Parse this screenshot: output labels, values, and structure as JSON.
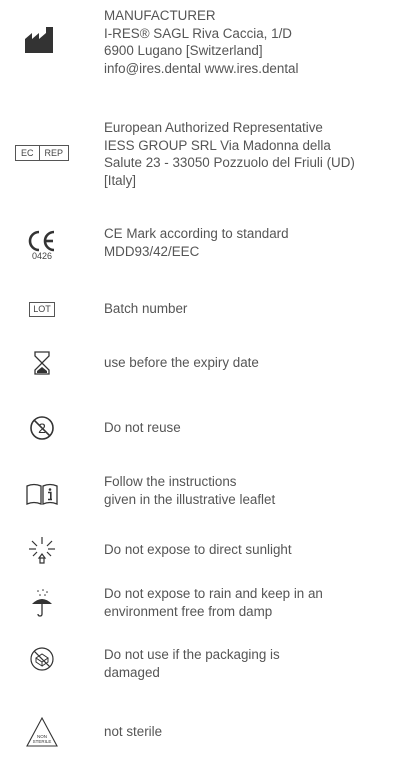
{
  "entries": [
    {
      "symbol": "manufacturer-icon",
      "lines": "MANUFACTURER\nI-RES® SAGL Riva Caccia, 1/D\n6900 Lugano [Switzerland]\ninfo@ires.dental www.ires.dental"
    },
    {
      "symbol": "ec-rep-label",
      "ec": "EC",
      "rep": "REP",
      "lines": "European Authorized Representative\nIESS GROUP SRL Via Madonna della\nSalute 23 - 33050 Pozzuolo del Friuli (UD)\n[Italy]"
    },
    {
      "symbol": "ce-mark",
      "number": "0426",
      "lines": "CE Mark according to standard\nMDD93/42/EEC"
    },
    {
      "symbol": "lot-label",
      "label": "LOT",
      "lines": "Batch number"
    },
    {
      "symbol": "hourglass-icon",
      "lines": "use before the expiry date"
    },
    {
      "symbol": "do-not-reuse-icon",
      "lines": "Do not reuse"
    },
    {
      "symbol": "instructions-book-icon",
      "lines": "Follow the instructions\ngiven in the illustrative leaflet"
    },
    {
      "symbol": "sunlight-icon",
      "lines": "Do not expose to direct sunlight"
    },
    {
      "symbol": "umbrella-icon",
      "lines": "Do not expose to rain and keep in an\nenvironment free from damp"
    },
    {
      "symbol": "damaged-package-icon",
      "lines": "Do not use if the packaging is\ndamaged"
    },
    {
      "symbol": "non-sterile-icon",
      "badge": "NON\nSTERILE",
      "lines": "not sterile"
    }
  ],
  "colors": {
    "text": "#555555",
    "icon": "#333333"
  }
}
